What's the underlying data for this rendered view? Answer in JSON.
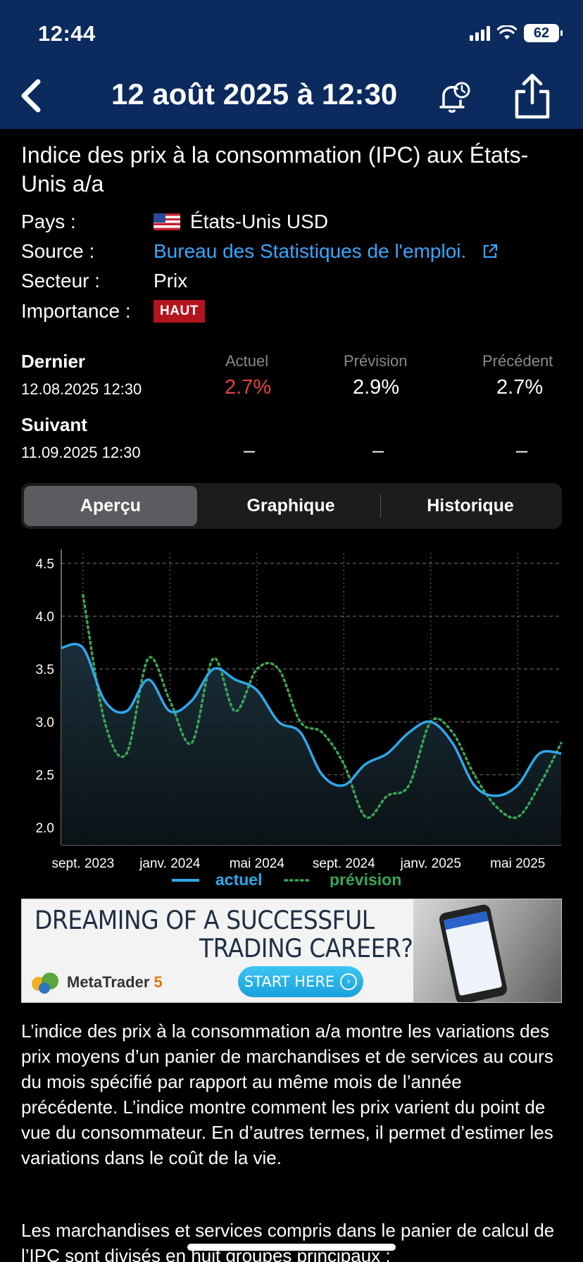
{
  "status_bar": {
    "time": "12:44",
    "battery": "62"
  },
  "nav": {
    "title": "12 août 2025 à 12:30"
  },
  "event": {
    "title": "Indice des prix à la consommation (IPC) aux États-Unis a/a",
    "country_label": "Pays :",
    "country_value": "États-Unis USD",
    "source_label": "Source :",
    "source_value": "Bureau des Statistiques de l'emploi.",
    "sector_label": "Secteur :",
    "sector_value": "Prix",
    "importance_label": "Importance :",
    "importance_value": "HAUT"
  },
  "values": {
    "headers": {
      "actual": "Actuel",
      "forecast": "Prévision",
      "previous": "Précédent"
    },
    "last": {
      "label": "Dernier",
      "date": "12.08.2025 12:30",
      "actual": "2.7%",
      "forecast": "2.9%",
      "previous": "2.7%"
    },
    "next": {
      "label": "Suivant",
      "date": "11.09.2025 12:30",
      "actual": "–",
      "forecast": "–",
      "previous": "–"
    }
  },
  "tabs": [
    "Aperçu",
    "Graphique",
    "Historique"
  ],
  "chart_data": {
    "type": "line",
    "x": [
      "2023-08",
      "2023-09",
      "2023-10",
      "2023-11",
      "2023-12",
      "2024-01",
      "2024-02",
      "2024-03",
      "2024-04",
      "2024-05",
      "2024-06",
      "2024-07",
      "2024-08",
      "2024-09",
      "2024-10",
      "2024-11",
      "2024-12",
      "2025-01",
      "2025-02",
      "2025-03",
      "2025-04",
      "2025-05",
      "2025-06",
      "2025-07"
    ],
    "x_tick_labels": [
      "sept. 2023",
      "janv. 2024",
      "mai 2024",
      "sept. 2024",
      "janv. 2025",
      "mai 2025"
    ],
    "y_ticks": [
      "2.0",
      "2.5",
      "3.0",
      "3.5",
      "4.0",
      "4.5"
    ],
    "ylim": [
      1.9,
      4.6
    ],
    "series": [
      {
        "name": "actuel",
        "color": "#2fa8e8",
        "values": [
          3.7,
          3.7,
          3.2,
          3.1,
          3.4,
          3.1,
          3.2,
          3.5,
          3.4,
          3.3,
          3.0,
          2.9,
          2.5,
          2.4,
          2.6,
          2.7,
          2.9,
          3.0,
          2.8,
          2.4,
          2.3,
          2.4,
          2.7,
          2.7
        ]
      },
      {
        "name": "prévision",
        "color": "#3aa655",
        "dashed": true,
        "values": [
          null,
          4.2,
          3.0,
          2.7,
          3.6,
          3.2,
          2.8,
          3.6,
          3.1,
          3.5,
          3.5,
          3.0,
          2.9,
          2.6,
          2.1,
          2.3,
          2.4,
          3.0,
          2.9,
          2.5,
          2.2,
          2.1,
          2.4,
          2.8
        ]
      }
    ],
    "grid": true,
    "legend_position": "bottom"
  },
  "ad": {
    "line1": "DREAMING OF A SUCCESSFUL",
    "line2": "TRADING CAREER?",
    "logo_text": "MetaTrader",
    "logo_number": "5",
    "button": "START HERE"
  },
  "description": {
    "p1": "L’indice des prix à la consommation a/a montre les variations des prix moyens d’un panier de marchandises et de services au cours du mois spécifié par rapport au même mois de l’année précédente. L’indice montre comment les prix varient du point de vue du consommateur. En d’autres termes, il permet d’estimer les variations dans le coût de la vie.",
    "p2": "Les marchandises et services compris dans le panier de calcul de l’IPC sont divisés en huit groupes principaux :"
  }
}
